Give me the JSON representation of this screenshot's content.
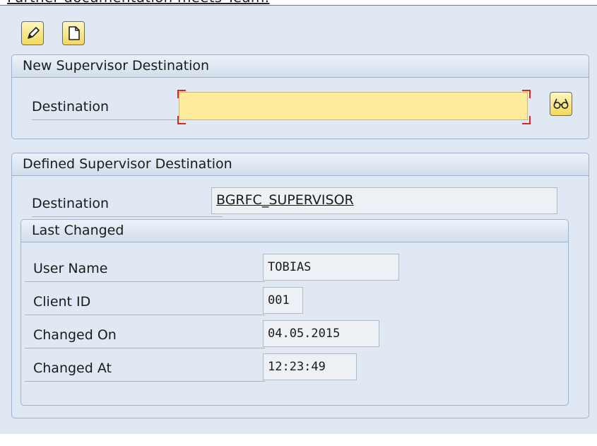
{
  "top_text": "Further documentation meets Team:",
  "toolbar": {
    "edit_icon": "pencil-icon",
    "new_icon": "blank-document-icon"
  },
  "new_group": {
    "title": "New Supervisor Destination",
    "destination_label": "Destination",
    "destination_value": "",
    "search_help_icon": "glasses-icon"
  },
  "defined_group": {
    "title": "Defined Supervisor Destination",
    "destination_label": "Destination",
    "destination_value": "BGRFC_SUPERVISOR",
    "last_changed": {
      "title": "Last Changed",
      "user_name_label": "User Name",
      "user_name_value": "TOBIAS",
      "client_id_label": "Client ID",
      "client_id_value": "001",
      "changed_on_label": "Changed On",
      "changed_on_value": "04.05.2015",
      "changed_at_label": "Changed At",
      "changed_at_value": "12:23:49"
    }
  },
  "colors": {
    "background": "#dfe8f3",
    "required_input": "#ffeb9c",
    "required_marker": "#e0261b",
    "group_border": "#9fb4cc"
  }
}
